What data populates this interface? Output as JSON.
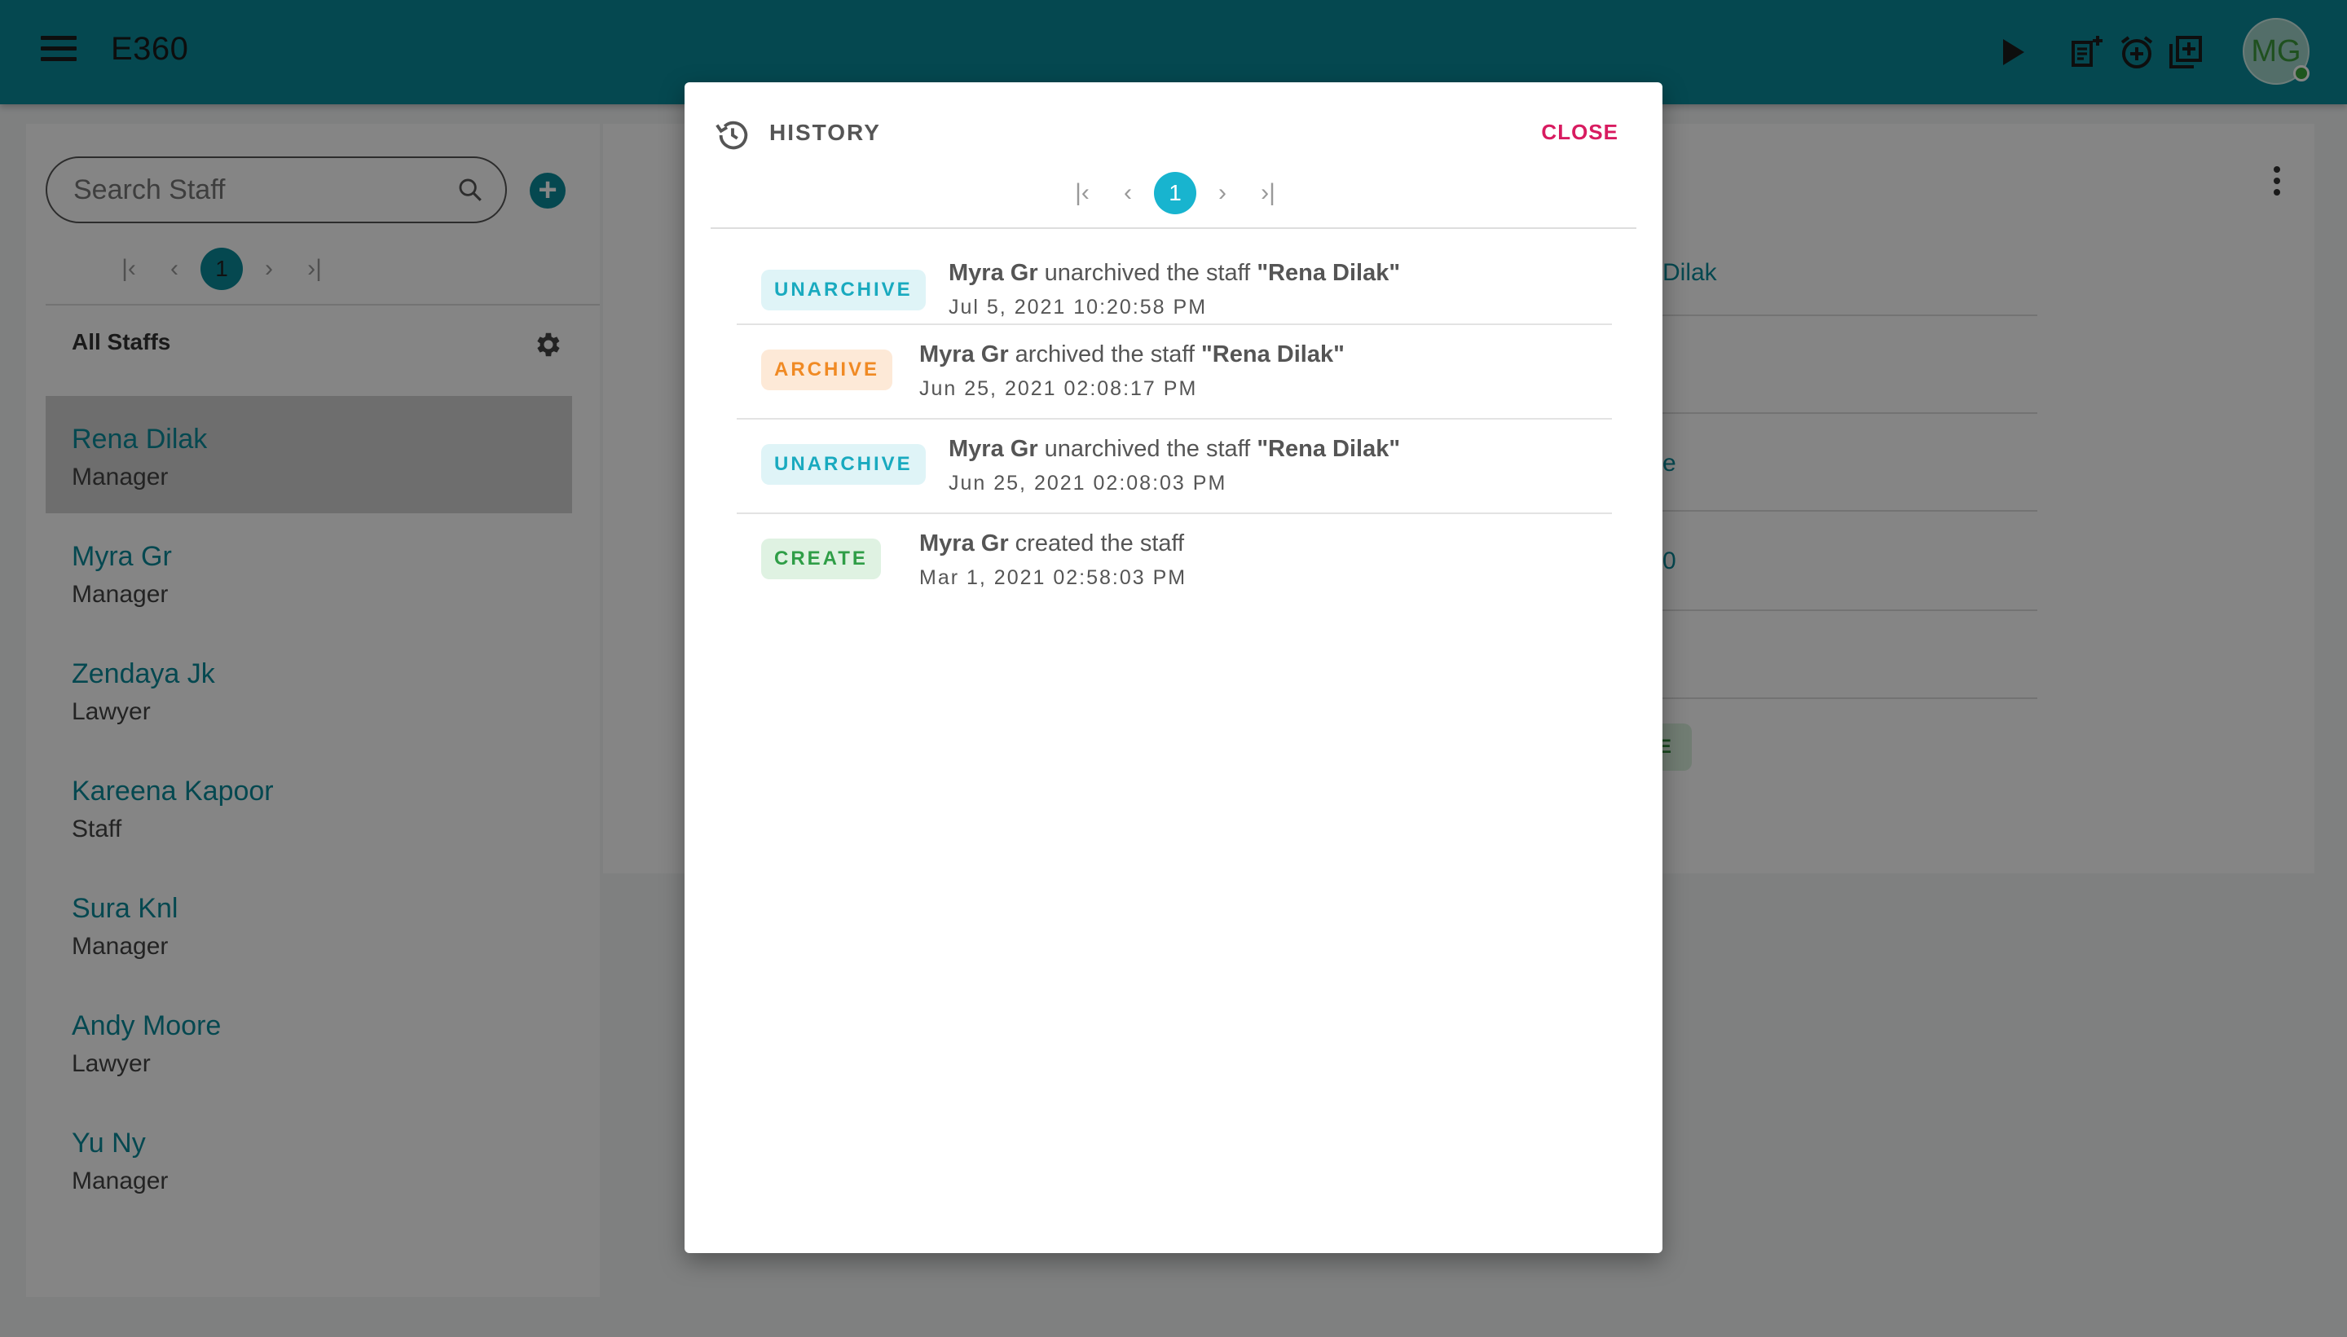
{
  "app": {
    "title": "E360",
    "avatar_initials": "MG"
  },
  "sidebar": {
    "search_placeholder": "Search Staff",
    "pager": {
      "current_page": "1"
    },
    "list_title": "All Staffs",
    "staff": [
      {
        "name": "Rena Dilak",
        "role": "Manager",
        "selected": true
      },
      {
        "name": "Myra Gr",
        "role": "Manager"
      },
      {
        "name": "Zendaya Jk",
        "role": "Lawyer"
      },
      {
        "name": "Kareena Kapoor",
        "role": "Staff"
      },
      {
        "name": "Sura Knl",
        "role": "Manager"
      },
      {
        "name": "Andy Moore",
        "role": "Lawyer"
      },
      {
        "name": "Yu Ny",
        "role": "Manager"
      }
    ]
  },
  "detail": {
    "visible_fragments": [
      "Dilak",
      "e",
      "0"
    ],
    "badge_fragment": "E"
  },
  "dialog": {
    "title": "HISTORY",
    "close_label": "CLOSE",
    "pager": {
      "current_page": "1"
    },
    "entries": [
      {
        "tag": "UNARCHIVE",
        "actor": "Myra Gr",
        "action": " unarchived the staff ",
        "target": "\"Rena Dilak\"",
        "time": "Jul 5, 2021 10:20:58 PM"
      },
      {
        "tag": "ARCHIVE",
        "actor": "Myra Gr",
        "action": " archived the staff ",
        "target": "\"Rena Dilak\"",
        "time": "Jun 25, 2021 02:08:17 PM"
      },
      {
        "tag": "UNARCHIVE",
        "actor": "Myra Gr",
        "action": " unarchived the staff ",
        "target": "\"Rena Dilak\"",
        "time": "Jun 25, 2021 02:08:03 PM"
      },
      {
        "tag": "CREATE",
        "actor": "Myra Gr",
        "action": " created the staff",
        "target": "",
        "time": "Mar 1, 2021 02:58:03 PM"
      }
    ]
  },
  "colors": {
    "primary": "#0a8a9a",
    "accent_close": "#d81b60",
    "unarchive": "#19aabf",
    "archive": "#f08a24",
    "create": "#2f9e47"
  }
}
